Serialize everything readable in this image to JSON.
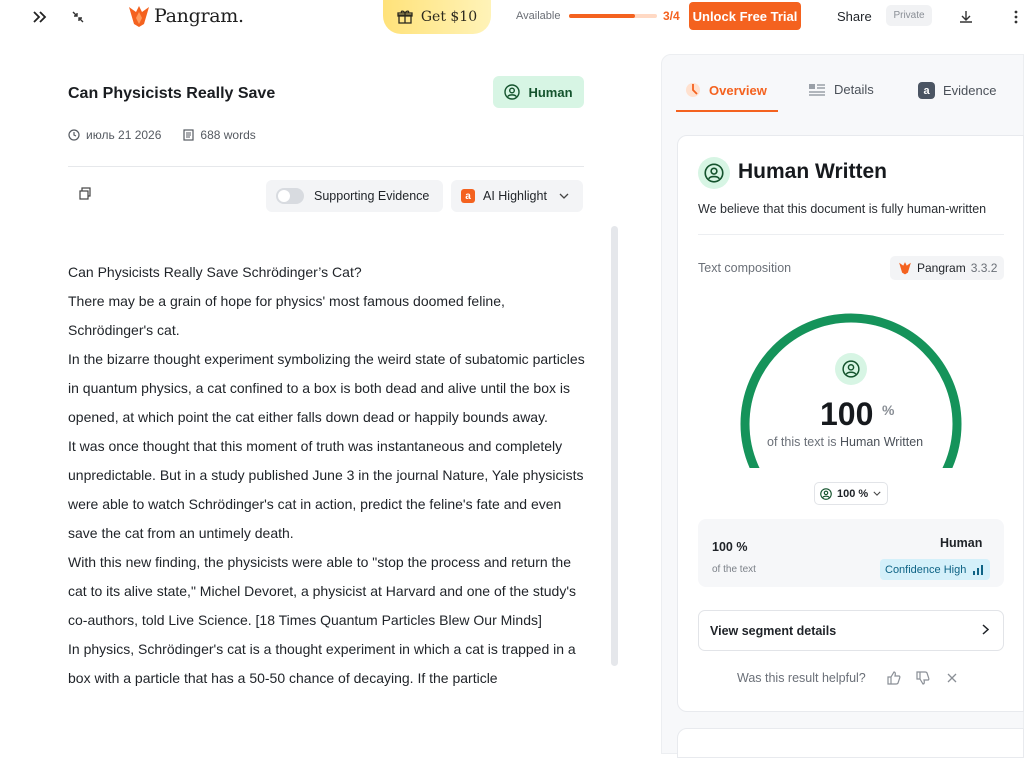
{
  "topbar": {
    "brand": "Pangram.",
    "gift_label": "Get $10",
    "available_label": "Available",
    "progress_fraction": 0.75,
    "progress_count": "3/4",
    "trial_label": "Unlock Free Trial",
    "share_label": "Share",
    "private_label": "Private"
  },
  "document": {
    "title": "Can Physicists Really Save",
    "badge": "Human",
    "date": "июль 21 2026",
    "words": "688 words",
    "supporting_evidence_label": "Supporting Evidence",
    "ai_highlight_label": "AI Highlight",
    "paragraphs": [
      "Can Physicists Really Save Schrödinger’s Cat?",
      "There may be a grain of hope for physics' most famous doomed feline, Schrödinger's cat.",
      "In the bizarre thought experiment symbolizing the weird state of subatomic particles in quantum physics, a cat confined to a box is both dead and alive until the box is opened, at which point the cat either falls down dead or happily bounds away.",
      "It was once thought that this moment of truth was instantaneous and completely unpredictable. But in a study published June 3 in the journal Nature, Yale physicists were able to watch Schrödinger's cat in action, predict the feline's fate and even save the cat from an untimely death.",
      "With this new finding, the physicists were able to \"stop the process and return the cat to its alive state,\" Michel Devoret, a physicist at Harvard and one of the study's co-authors, told Live Science. [18 Times Quantum Particles Blew Our Minds]",
      "In physics, Schrödinger's cat is a thought experiment in which a cat is trapped in a box with a particle that has a 50-50 chance of decaying. If the particle"
    ]
  },
  "panel": {
    "tabs": [
      "Overview",
      "Details",
      "Evidence"
    ],
    "result_title": "Human Written",
    "result_desc": "We believe that this document is fully human-written",
    "text_composition_label": "Text composition",
    "model_name": "Pangram",
    "model_version": "3.3.2",
    "gauge_fraction": 1.0,
    "gauge_value": "100",
    "gauge_unit": "%",
    "gauge_caption_prefix": "of this text is",
    "gauge_caption_emph": "Human Written",
    "select_value": "100 %",
    "stat_pct": "100 %",
    "stat_of": "of the text",
    "stat_label": "Human",
    "confidence_label": "Confidence High",
    "segment_button": "View segment details",
    "helpful_question": "Was this result helpful?"
  },
  "colors": {
    "accent": "#f4621f",
    "human_green": "#15935a",
    "badge_green_bg": "#d7f5e4"
  }
}
